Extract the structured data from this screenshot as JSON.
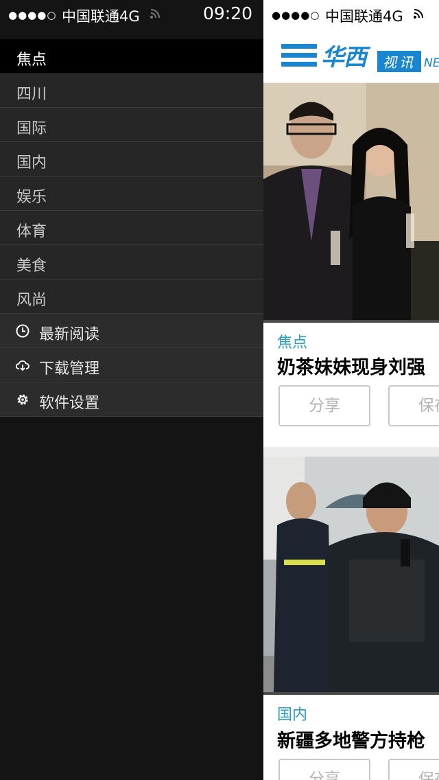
{
  "status_bar_left": {
    "signal": "●●●●○",
    "carrier": "中国联通4G",
    "time": "09:20"
  },
  "status_bar_right": {
    "signal": "●●●●○",
    "carrier": "中国联通4G"
  },
  "drawer": {
    "categories": [
      {
        "label": "焦点",
        "active": true
      },
      {
        "label": "四川"
      },
      {
        "label": "国际"
      },
      {
        "label": "国内"
      },
      {
        "label": "娱乐"
      },
      {
        "label": "体育"
      },
      {
        "label": "美食"
      },
      {
        "label": "风尚"
      }
    ],
    "utilities": [
      {
        "label": "最新阅读",
        "icon": "clock-icon"
      },
      {
        "label": "下载管理",
        "icon": "cloud-download-icon"
      },
      {
        "label": "软件设置",
        "icon": "gear-icon"
      }
    ]
  },
  "header": {
    "logo_main": "华西",
    "logo_sub": "视讯",
    "logo_tail": "NE"
  },
  "articles": [
    {
      "category": "焦点",
      "title": "奶茶妹妹现身刘强",
      "share": "分享",
      "save": "保存"
    },
    {
      "category": "国内",
      "title": "新疆多地警方持枪",
      "share": "分享",
      "save": "保存"
    }
  ],
  "colors": {
    "accent": "#1a86d0",
    "category": "#27a0c8",
    "drawer_bg": "#141414",
    "active_bg": "#000000"
  }
}
